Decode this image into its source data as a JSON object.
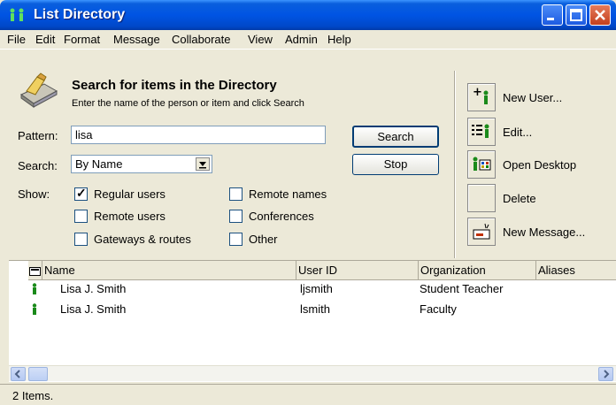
{
  "window": {
    "title": "List Directory"
  },
  "menu": [
    "File",
    "Edit",
    "Format",
    "Message",
    "Collaborate",
    "View",
    "Admin",
    "Help"
  ],
  "header": {
    "title": "Search for items in the Directory",
    "subtitle": "Enter the name of the person or item and click Search"
  },
  "form": {
    "pattern_label": "Pattern:",
    "pattern_value": "lisa",
    "search_label": "Search:",
    "search_value": "By Name",
    "show_label": "Show:",
    "search_button": "Search",
    "stop_button": "Stop",
    "checkboxes": [
      {
        "label": "Regular users",
        "checked": true
      },
      {
        "label": "Remote users",
        "checked": false
      },
      {
        "label": "Gateways & routes",
        "checked": false
      },
      {
        "label": "Remote names",
        "checked": false
      },
      {
        "label": "Conferences",
        "checked": false
      },
      {
        "label": "Other",
        "checked": false
      }
    ]
  },
  "actions": [
    {
      "label": "New User...",
      "icon": "new-user-icon"
    },
    {
      "label": "Edit...",
      "icon": "edit-user-icon"
    },
    {
      "label": "Open Desktop",
      "icon": "open-desktop-icon"
    },
    {
      "label": "Delete",
      "icon": ""
    },
    {
      "label": "New Message...",
      "icon": "new-message-icon"
    }
  ],
  "table": {
    "columns": [
      "Name",
      "User ID",
      "Organization",
      "Aliases"
    ],
    "rows": [
      {
        "name": "Lisa J. Smith",
        "user_id": "ljsmith",
        "organization": "Student Teacher",
        "aliases": ""
      },
      {
        "name": "Lisa J. Smith",
        "user_id": "lsmith",
        "organization": "Faculty",
        "aliases": ""
      }
    ]
  },
  "status": {
    "text": "2 Items."
  },
  "colors": {
    "titlebar": "#0054e3",
    "face": "#ece9d8",
    "user_icon": "#1a8a1a"
  }
}
